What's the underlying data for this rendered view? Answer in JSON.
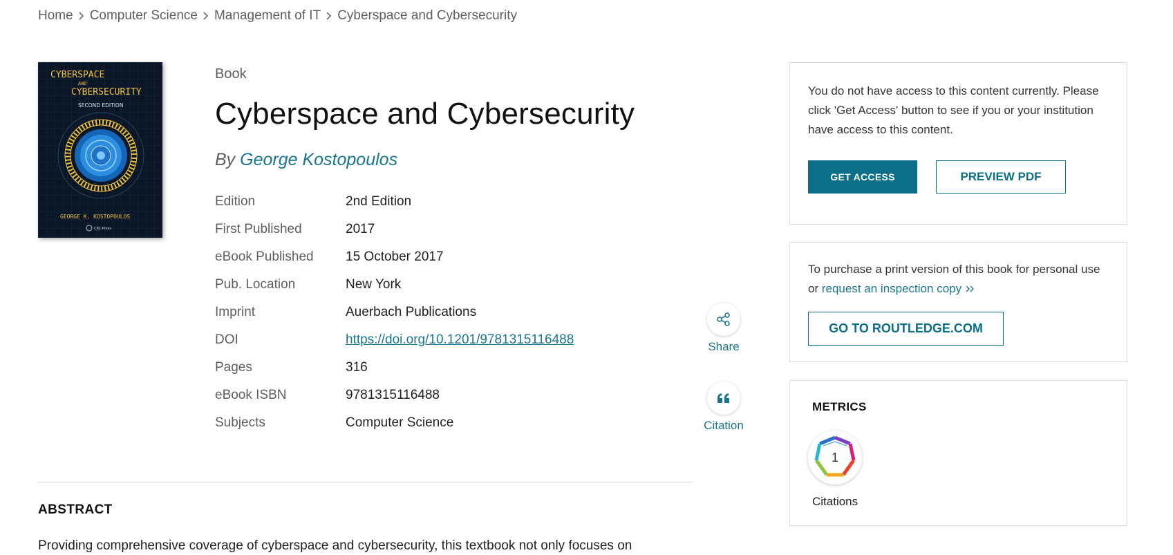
{
  "breadcrumb": {
    "items": [
      "Home",
      "Computer Science",
      "Management of IT",
      "Cyberspace and Cybersecurity"
    ]
  },
  "cover": {
    "title_line1": "CYBERSPACE",
    "title_line2": "AND",
    "title_line3": "CYBERSECURITY",
    "edition": "SECOND EDITION",
    "author": "GEORGE K. KOSTOPOULOS",
    "publisher": "CRC Press"
  },
  "book": {
    "type": "Book",
    "title": "Cyberspace and Cybersecurity",
    "by_prefix": "By",
    "author": "George Kostopoulos"
  },
  "details": [
    {
      "label": "Edition",
      "value": "2nd Edition"
    },
    {
      "label": "First Published",
      "value": "2017"
    },
    {
      "label": "eBook Published",
      "value": "15 October 2017"
    },
    {
      "label": "Pub. Location",
      "value": "New York"
    },
    {
      "label": "Imprint",
      "value": "Auerbach Publications"
    },
    {
      "label": "DOI",
      "value": "https://doi.org/10.1201/9781315116488"
    },
    {
      "label": "Pages",
      "value": "316"
    },
    {
      "label": "eBook ISBN",
      "value": "9781315116488"
    },
    {
      "label": "Subjects",
      "value": "Computer Science"
    }
  ],
  "actions": {
    "share": {
      "label": "Share",
      "icon": "share-icon"
    },
    "citation": {
      "label": "Citation",
      "icon": "quote-icon"
    }
  },
  "access_panel": {
    "message": "You do not have access to this content currently. Please click 'Get Access' button to see if you or your institution have access to this content.",
    "get_access": "GET ACCESS",
    "preview_pdf": "PREVIEW PDF"
  },
  "purchase_panel": {
    "message": "To purchase a print version of this book for personal use or",
    "link": "request an inspection copy",
    "button": "GO TO ROUTLEDGE.COM"
  },
  "metrics_panel": {
    "title": "METRICS",
    "count": "1",
    "label": "Citations"
  },
  "abstract": {
    "heading": "ABSTRACT",
    "text": "Providing comprehensive coverage of cyberspace and cybersecurity, this textbook not only focuses on"
  },
  "colors": {
    "accent": "#0b6f8a",
    "link": "#1a7591",
    "muted_text": "#5e5e5e",
    "border": "#dcdcdc"
  }
}
